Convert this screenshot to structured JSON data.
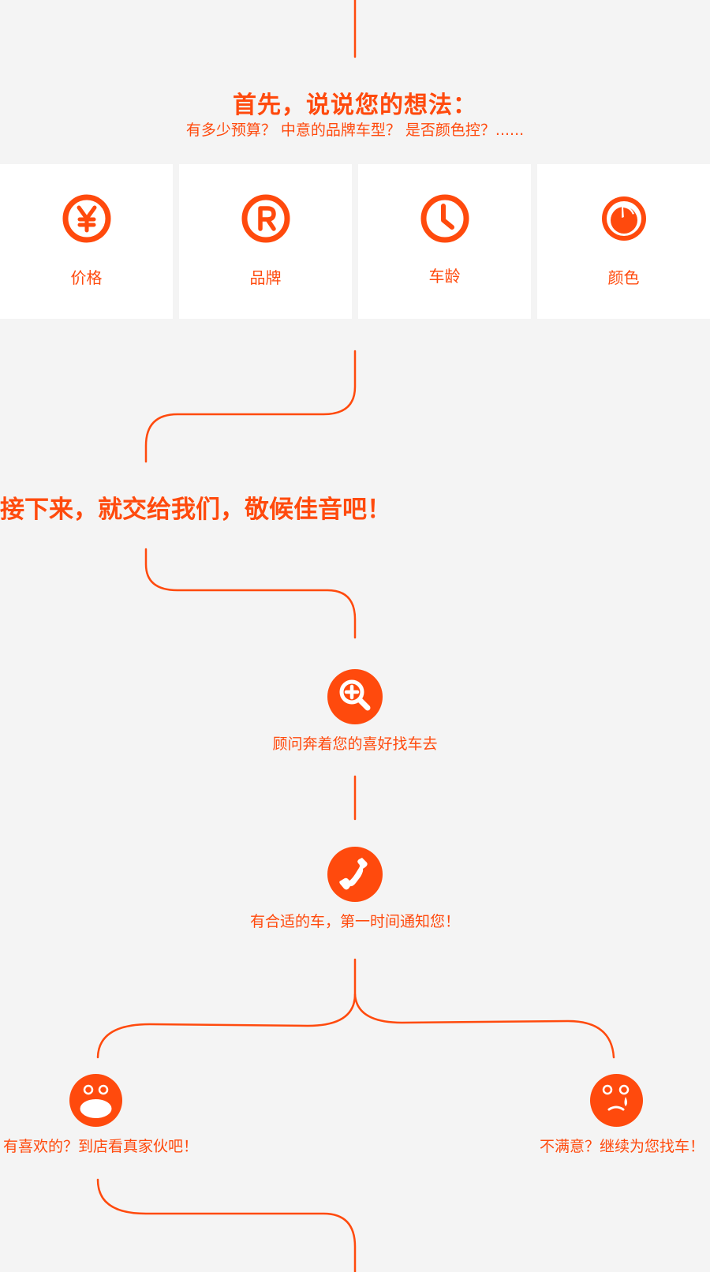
{
  "section1": {
    "title": "首先，说说您的想法：",
    "subtitle": "有多少预算？ 中意的品牌车型？ 是否颜色控？......"
  },
  "cards": [
    {
      "label": "价格",
      "icon": "yen-icon"
    },
    {
      "label": "品牌",
      "icon": "registered-icon"
    },
    {
      "label": "车龄",
      "icon": "clock-icon"
    },
    {
      "label": "颜色",
      "icon": "pie-icon"
    }
  ],
  "section2": {
    "headline": "接下来，就交给我们，敬候佳音吧！"
  },
  "steps": [
    {
      "text": "顾问奔着您的喜好找车去",
      "icon": "search-plus-icon"
    },
    {
      "text": "有合适的车，第一时间通知您！",
      "icon": "phone-icon"
    }
  ],
  "branches": {
    "left": {
      "text": "有喜欢的？到店看真家伙吧！",
      "icon": "happy-face-icon"
    },
    "right": {
      "text": "不满意？继续为您找车！",
      "icon": "crying-face-icon"
    }
  },
  "colors": {
    "accent": "#ff4a0d",
    "background": "#f4f4f4",
    "card": "#ffffff"
  }
}
